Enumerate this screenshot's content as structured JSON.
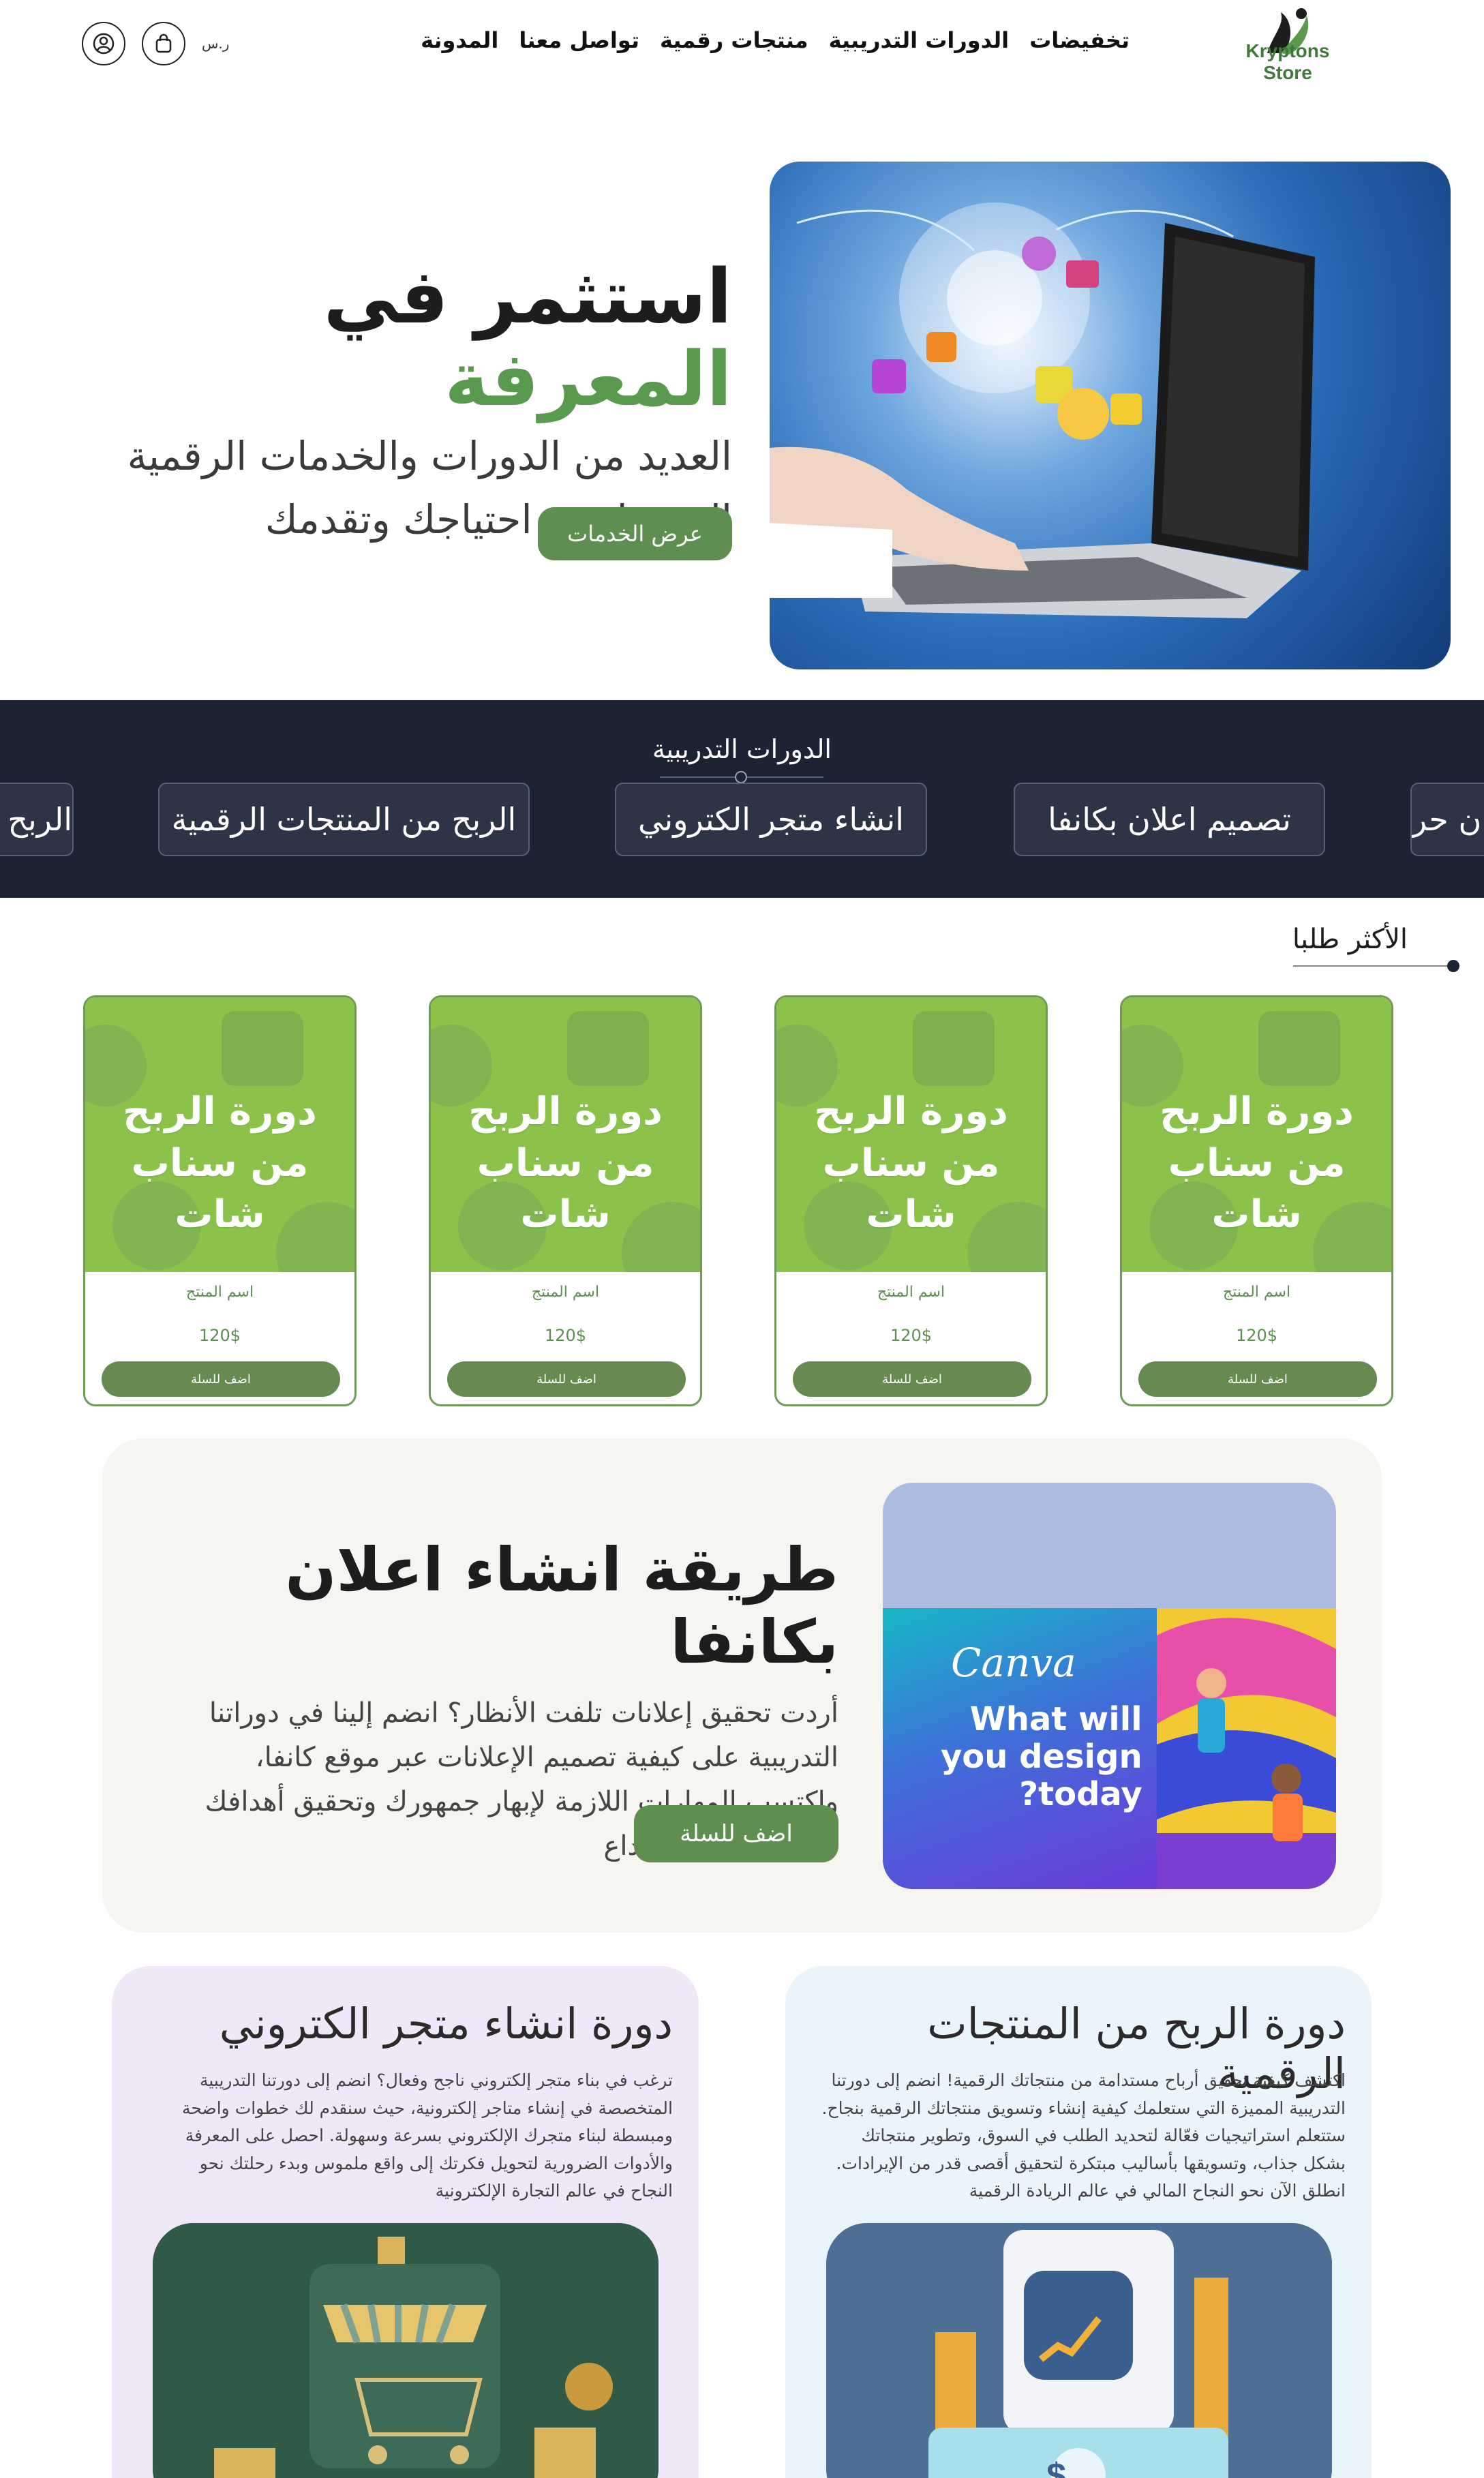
{
  "brand": {
    "name": "Kryptons Store"
  },
  "nav": {
    "items": [
      "تخفيضات",
      "الدورات التدريبية",
      "منتجات رقمية",
      "تواصل معنا",
      "المدونة"
    ]
  },
  "header": {
    "currency": "ر.س",
    "cart_icon": "bag-icon",
    "account_icon": "user-icon"
  },
  "hero": {
    "title_part1": "استثمر في ",
    "title_accent": "المعرفة",
    "subtitle_line1": "العديد من الدورات والخدمات الرقمية",
    "subtitle_line2": "التي تناسب احتياجك وتقدمك",
    "button": "عرض الخدمات",
    "colors": {
      "accent": "#5a9a4e",
      "button": "#5e8f50"
    }
  },
  "courses_band": {
    "title": "الدورات التدريبية",
    "chips": [
      "الربح",
      "الربح من المنتجات الرقمية",
      "انشاء متجر الكتروني",
      "تصميم اعلان بكانفا",
      "ن حر"
    ],
    "background": "#1c2433"
  },
  "most_requested": {
    "title": "الأكثر طلبا",
    "products": [
      {
        "image_title_line1": "دورة الربح",
        "image_title_line2": "من سناب شات",
        "name": "اسم المنتج",
        "price": "120$",
        "button": "اضف للسلة"
      },
      {
        "image_title_line1": "دورة الربح",
        "image_title_line2": "من سناب شات",
        "name": "اسم المنتج",
        "price": "120$",
        "button": "اضف للسلة"
      },
      {
        "image_title_line1": "دورة الربح",
        "image_title_line2": "من سناب شات",
        "name": "اسم المنتج",
        "price": "120$",
        "button": "اضف للسلة"
      },
      {
        "image_title_line1": "دورة الربح",
        "image_title_line2": "من سناب شات",
        "name": "اسم المنتج",
        "price": "120$",
        "button": "اضف للسلة"
      }
    ]
  },
  "feature": {
    "title": "طريقة انشاء اعلان بكانفا",
    "desc_line1": "أردت تحقيق إعلانات تلفت الأنظار؟ انضم إلينا في دوراتنا",
    "desc_line2": "التدريبية على كيفية تصميم الإعلانات عبر موقع كانفا،",
    "desc_line3": "واكتسب المهارات اللازمة لإبهار جمهورك وتحقيق أهدافك",
    "desc_line4": "التسويقية بثقة وإبداع",
    "button": "اضف للسلة",
    "image": {
      "logo": "Canva",
      "tagline1": "What will",
      "tagline2": "you design",
      "tagline3": "today?"
    }
  },
  "bottom_cards": [
    {
      "title": "دورة الربح من المنتجات الرقمية",
      "lines": [
        "اكتشف كيفية تحقيق أرباح مستدامة من منتجاتك الرقمية! انضم إلى دورتنا",
        "التدريبية المميزة التي ستعلمك كيفية إنشاء وتسويق منتجاتك الرقمية بنجاح.",
        "ستتعلم استراتيجيات فعّالة لتحديد الطلب في السوق، وتطوير منتجاتك",
        "بشكل جذاب، وتسويقها بأساليب مبتكرة لتحقيق أقصى قدر من الإيرادات.",
        "انطلق الآن نحو النجاح المالي في عالم الريادة الرقمية"
      ]
    },
    {
      "title": "دورة انشاء متجر الكتروني",
      "lines": [
        "ترغب في بناء متجر إلكتروني ناجح وفعال؟ انضم إلى دورتنا التدريبية",
        "المتخصصة في إنشاء متاجر إلكترونية، حيث سنقدم لك خطوات واضحة",
        "ومبسطة لبناء متجرك الإلكتروني بسرعة وسهولة. احصل على المعرفة",
        "والأدوات الضرورية لتحويل فكرتك إلى واقع ملموس وبدء رحلتك نحو",
        "النجاح في عالم التجارة الإلكترونية"
      ]
    }
  ]
}
